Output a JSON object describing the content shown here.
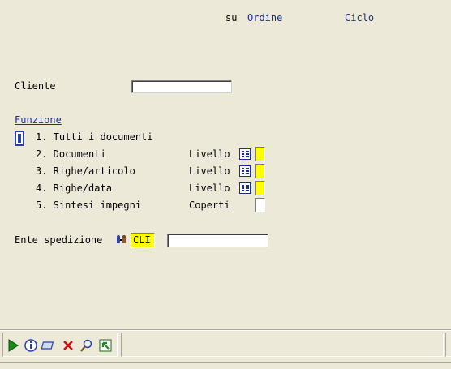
{
  "header": {
    "su_label": "su",
    "ordine_label": "Ordine",
    "ciclo_label": "Ciclo"
  },
  "cliente": {
    "label": "Cliente",
    "value": ""
  },
  "funzione": {
    "title": "Funzione",
    "options": [
      {
        "label": "1. Tutti i documenti"
      },
      {
        "label": "2. Documenti",
        "extra_label": "Livello",
        "value": ""
      },
      {
        "label": "3. Righe/articolo",
        "extra_label": "Livello",
        "value": ""
      },
      {
        "label": "4. Righe/data",
        "extra_label": "Livello",
        "value": ""
      },
      {
        "label": "5. Sintesi impegni",
        "extra_label": "Coperti",
        "value": ""
      }
    ]
  },
  "ente": {
    "label": "Ente spedizione",
    "code": "CLI",
    "description": ""
  },
  "toolbar": {
    "buttons": [
      "run-icon",
      "info-icon",
      "window-icon",
      "cancel-icon",
      "search-icon",
      "exit-icon"
    ]
  },
  "colors": {
    "background": "#ece9d8",
    "accent": "#1c2f8f",
    "highlight": "#ffff00"
  }
}
